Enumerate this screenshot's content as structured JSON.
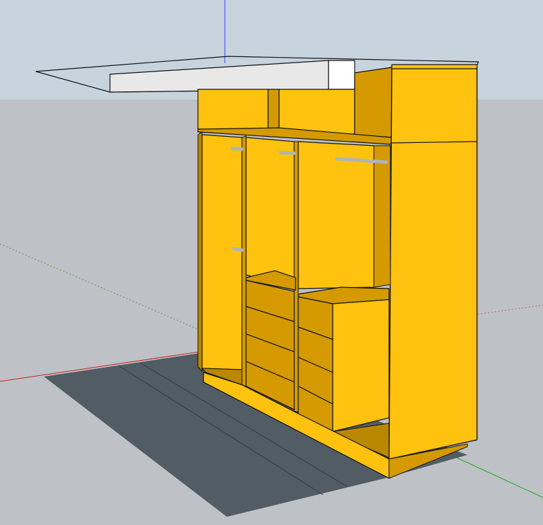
{
  "scene": {
    "title": "",
    "sky_color": "#c7d3dd",
    "ground_color": "#bec1c5",
    "shadow_color": "#515c64",
    "body_color": "#ffc20e",
    "interior_color": "#d49a00",
    "floor_color": "#b98700",
    "roof_panel_color": "#e8e8e8",
    "edge_color": "#111111",
    "axis_colors": {
      "blue": "#3344ff",
      "red": "#cc2222",
      "green": "#22aa22"
    }
  }
}
